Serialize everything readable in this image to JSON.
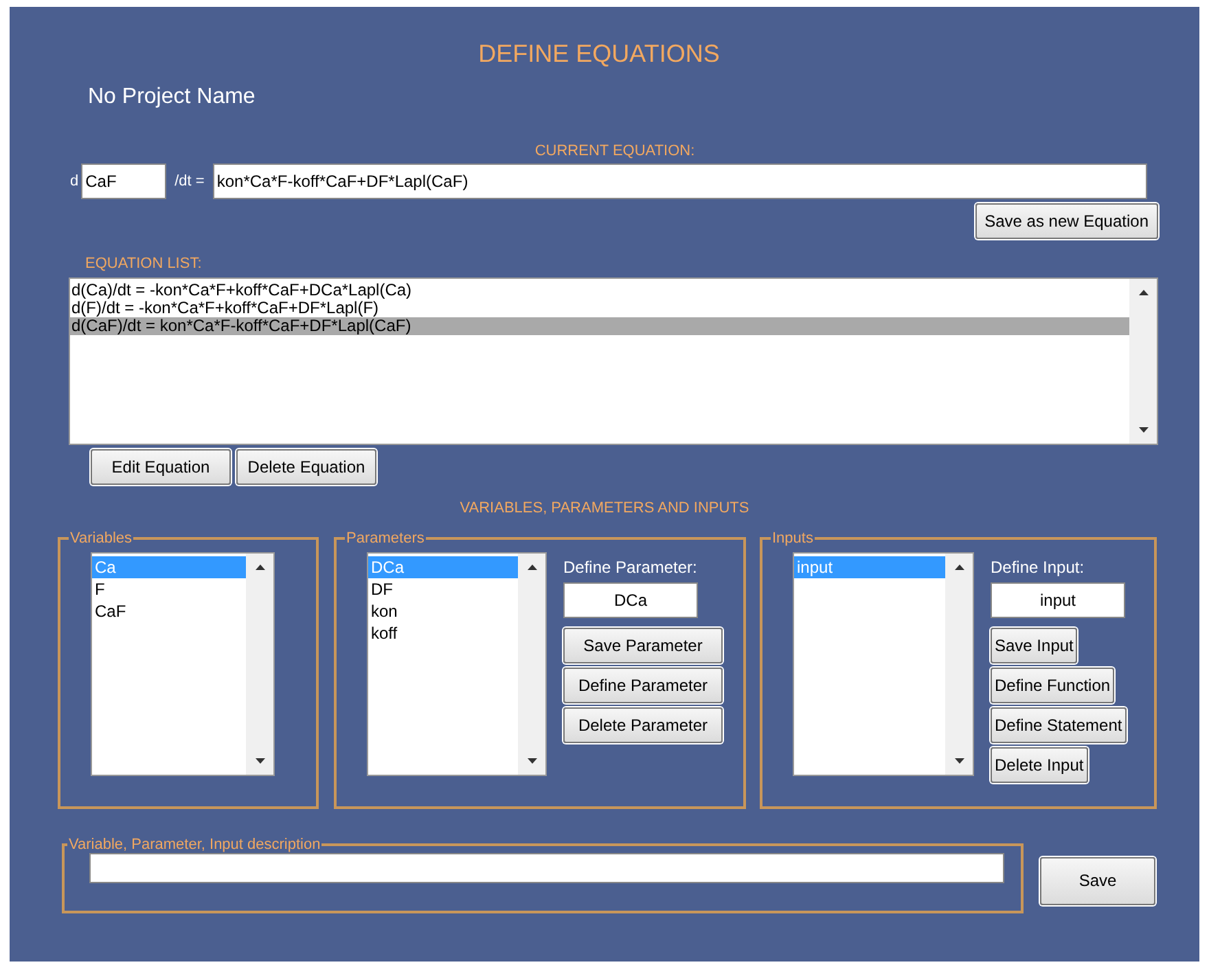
{
  "title": "DEFINE EQUATIONS",
  "project_name": "No Project Name",
  "current_equation": {
    "heading": "CURRENT EQUATION:",
    "prefix": "d",
    "variable": "CaF",
    "operator": "/dt =",
    "expression": "kon*Ca*F-koff*CaF+DF*Lapl(CaF)",
    "save_button": "Save as new Equation"
  },
  "equation_list": {
    "heading": "EQUATION LIST:",
    "items": [
      {
        "text": "d(Ca)/dt = -kon*Ca*F+koff*CaF+DCa*Lapl(Ca)",
        "selected": false
      },
      {
        "text": "d(F)/dt = -kon*Ca*F+koff*CaF+DF*Lapl(F)",
        "selected": false
      },
      {
        "text": "d(CaF)/dt = kon*Ca*F-koff*CaF+DF*Lapl(CaF)",
        "selected": true
      }
    ],
    "buttons": [
      "Edit Equation",
      "Delete Equation"
    ]
  },
  "section_heading": "VARIABLES, PARAMETERS AND INPUTS",
  "groups": [
    {
      "kind": "variables",
      "title": "Variables",
      "items": [
        {
          "text": "Ca",
          "selected": true
        },
        {
          "text": "F",
          "selected": false
        },
        {
          "text": "CaF",
          "selected": false
        }
      ]
    },
    {
      "kind": "parameters",
      "title": "Parameters",
      "items": [
        {
          "text": "DCa",
          "selected": true
        },
        {
          "text": "DF",
          "selected": false
        },
        {
          "text": "kon",
          "selected": false
        },
        {
          "text": "koff",
          "selected": false
        }
      ],
      "field_label": "Define Parameter:",
      "field_value": "DCa",
      "buttons": [
        "Save Parameter",
        "Define Parameter",
        "Delete Parameter"
      ]
    },
    {
      "kind": "inputs",
      "title": "Inputs",
      "items": [
        {
          "text": "input",
          "selected": true
        }
      ],
      "field_label": "Define Input:",
      "field_value": "input",
      "buttons": [
        "Save Input",
        "Define Function",
        "Define Statement",
        "Delete Input"
      ]
    }
  ],
  "description": {
    "title": "Variable, Parameter, Input description",
    "save_button": "Save"
  }
}
